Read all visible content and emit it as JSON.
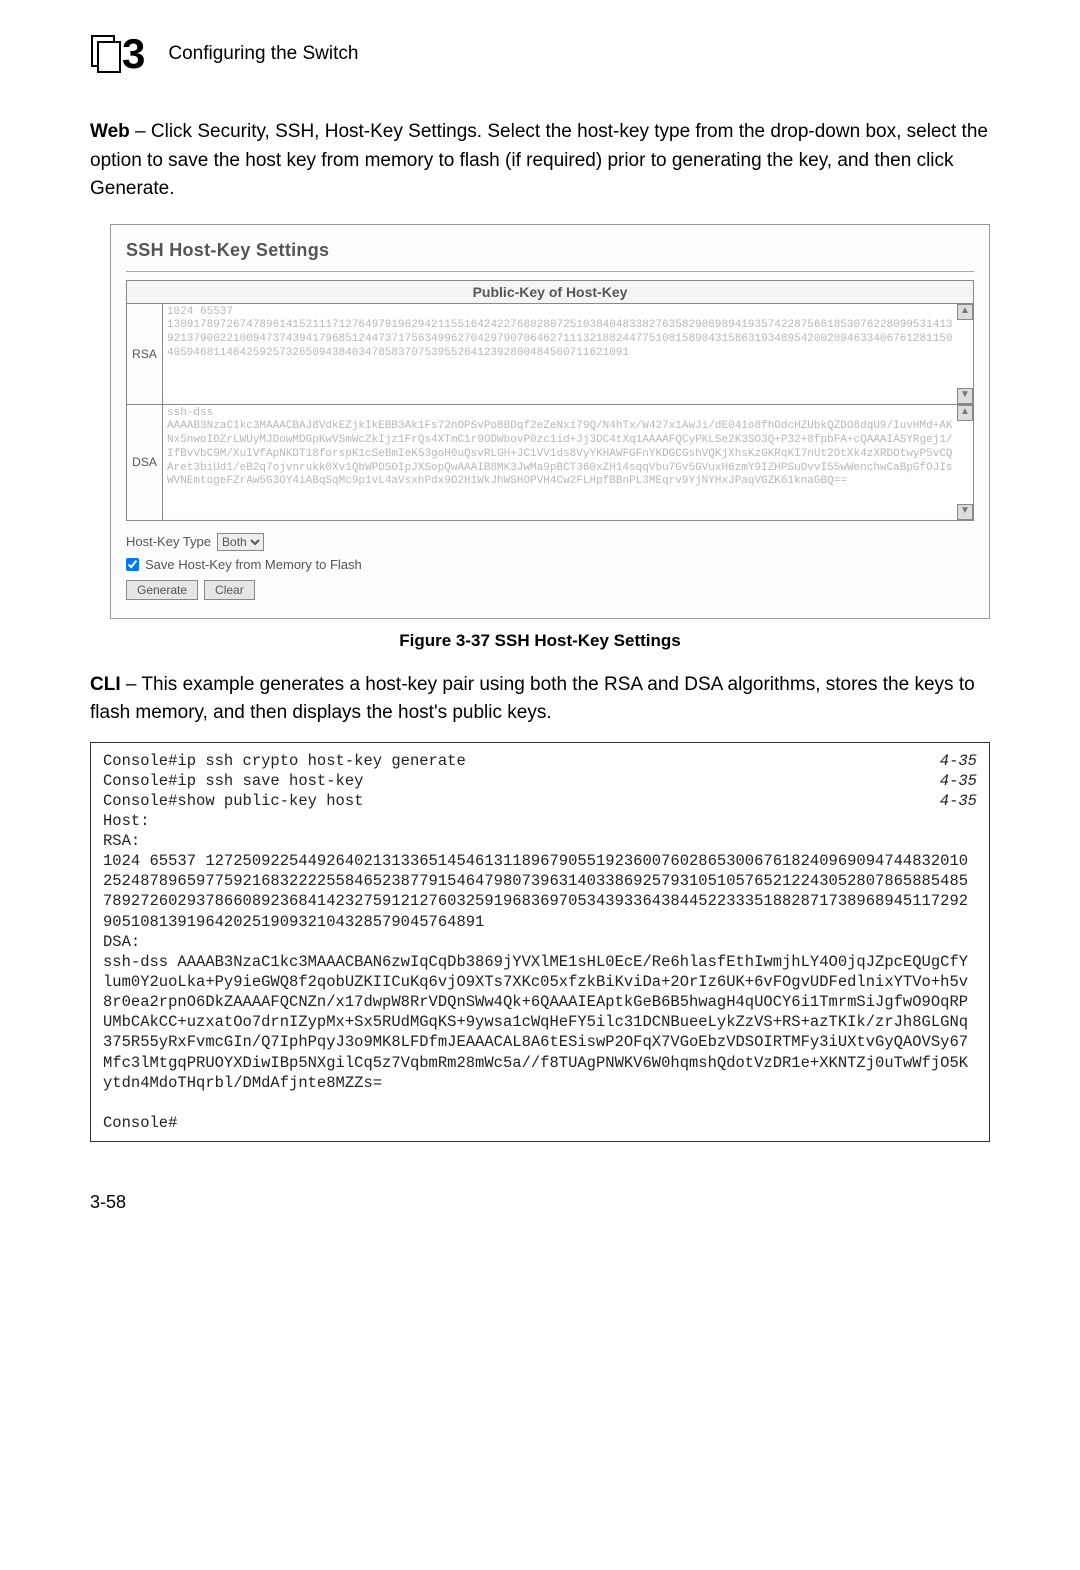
{
  "header": {
    "chapter_num": "3",
    "chapter_title": "Configuring the Switch"
  },
  "intro": {
    "lead": "Web",
    "text": " – Click Security, SSH, Host-Key Settings. Select the host-key type from the drop-down box, select the option to save the host key from memory to flash (if required) prior to generating the key, and then click Generate."
  },
  "screenshot": {
    "title": "SSH Host-Key Settings",
    "table_header": "Public-Key of Host-Key",
    "rows": [
      {
        "label": "RSA",
        "key": "1024 65537\n13091789726747896141521117127649791962942115516424227680280725103840483382763582906989419357422875661853076228099531413921379002210094737439417968512447371756349962704297907064627111321882447751081589043158631934895420020946334067612811504059468114642592573265094384034785837075395526412392800484500711621091"
      },
      {
        "label": "DSA",
        "key": "ssh-dss\nAAAAB3NzaC1kc3MAAACBAJ8VdkEZjkIkEBB3Ak1Fs72nOPSvPo8BDqf2eZeNxi79Q/N4hTx/W427x1AwJi/dE041o8fhOdcHZUbkQZDO8dqU9/IuvHMd+AKNx5nwoIDZrLWUyMJDowMDGpKwVSmWcZkIjz1FrQs4XTmC1r9ODWbovP0zc1id+Jj3DC4tXq1AAAAFQCyPKLSe2K3SO3Q+P32+8fpbFA+cQAAAIASYRgej1/IfBvVbC9M/XuIVfApNKDT18forspK1cSeBmIeK53goH0uQsvRLGH+JC1VV1ds8VyYKHAWFGFnYKDGCGshVQKjXhsKzGKRqKI7nUt2OtXk4zXRDOtwyP5vCQAret3biUd1/eB2q7ojvnrukk0Xv1QbWPDSOIpJXSopQwAAAIB8MK3JwMa9pBCT360xZH14sqqVbu7Gv5GVuxH6zmY9IZHPSuDvvI55wWenchwCaBpGfOJIsWVNEmtogeFZrAw5G3OY4iABqSqMc9p1vL4aVsxhPdx9O2H1WkJhWSHOPVH4Cw2FLHpfBBnPL3MEqrv9YjNYHxJPaqVGZK61knaGBQ=="
      }
    ],
    "hostkey_type_label": "Host-Key Type",
    "hostkey_type_value": "Both",
    "save_flash_label": "Save Host-Key from Memory to Flash",
    "btn_generate": "Generate",
    "btn_clear": "Clear"
  },
  "figure_caption": "Figure 3-37  SSH Host-Key Settings",
  "cli_intro": {
    "lead": "CLI",
    "text": " – This example generates a host-key pair using both the RSA and DSA algorithms, stores the keys to flash memory, and then displays the host's public keys."
  },
  "cli_box": {
    "lines": [
      {
        "cmd": "Console#ip ssh crypto host-key generate",
        "ref": "4-35"
      },
      {
        "cmd": "Console#ip ssh save host-key",
        "ref": "4-35"
      },
      {
        "cmd": "Console#show public-key host",
        "ref": "4-35"
      }
    ],
    "body": "Host:\nRSA:\n1024 65537 127250922544926402131336514546131189679055192360076028653006761824096909474483201025248789659775921683222255846523877915464798073963140338692579310510576521224305280786588548578927260293786608923684142327591212760325919683697053439336438445223335188287173896894511729290510813919642025190932104328579045764891\nDSA:\nssh-dss AAAAB3NzaC1kc3MAAACBAN6zwIqCqDb3869jYVXlME1sHL0EcE/Re6hlasfEthIwmjhLY4O0jqJZpcEQUgCfYlum0Y2uoLka+Py9ieGWQ8f2qobUZKIICuKq6vjO9XTs7XKc05xfzkBiKviDa+2OrIz6UK+6vFOgvUDFedlnixYTVo+h5v8r0ea2rpnO6DkZAAAAFQCNZn/x17dwpW8RrVDQnSWw4Qk+6QAAAIEAptkGeB6B5hwagH4qUOCY6i1TmrmSiJgfwO9OqRPUMbCAkCC+uzxatOo7drnIZypMx+Sx5RUdMGqKS+9ywsa1cWqHeFY5ilc31DCNBueeLykZzVS+RS+azTKIk/zrJh8GLGNq375R55yRxFvmcGIn/Q7IphPqyJ3o9MK8LFDfmJEAAACAL8A6tESiswP2OFqX7VGoEbzVDSOIRTMFy3iUXtvGyQAOVSy67Mfc3lMtgqPRUOYXDiwIBp5NXgilCq5z7VqbmRm28mWc5a//f8TUAgPNWKV6W0hqmshQdotVzDR1e+XKNTZj0uTwWfjO5Kytdn4MdoTHqrbl/DMdAfjnte8MZZs=\n\nConsole#"
  },
  "page_number": "3-58"
}
